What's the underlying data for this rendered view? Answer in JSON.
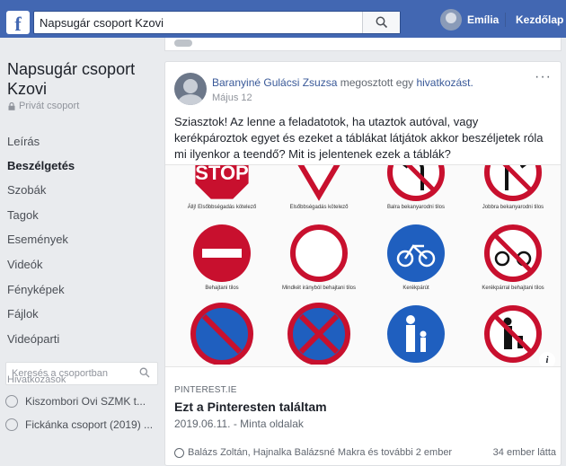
{
  "topbar": {
    "logo": "f",
    "search_value": "Napsugár csoport Kzovi",
    "user_name": "Emília",
    "home_label": "Kezdőlap"
  },
  "sidebar": {
    "group_title": "Napsugár csoport Kzovi",
    "privacy": "Privát csoport",
    "nav": [
      {
        "label": "Leírás"
      },
      {
        "label": "Beszélgetés"
      },
      {
        "label": "Szobák"
      },
      {
        "label": "Tagok"
      },
      {
        "label": "Események"
      },
      {
        "label": "Videók"
      },
      {
        "label": "Fényképek"
      },
      {
        "label": "Fájlok"
      },
      {
        "label": "Videóparti"
      }
    ],
    "search_placeholder": "Keresés a csoportban",
    "shortcuts_label": "Hivatkozások",
    "shortcuts": [
      {
        "label": "Kiszombori Ovi SZMK t..."
      },
      {
        "label": "Fickánka csoport (2019) ..."
      }
    ]
  },
  "post": {
    "author": "Baranyiné Gulácsi Zsuzsa",
    "action": "megosztott egy",
    "link_word": "hivatkozást.",
    "date": "Május 12",
    "more": "···",
    "text": "Sziasztok! Az lenne a feladatotok, ha utaztok autóval, vagy kerékpároztok egyet és ezeket a táblákat látjátok akkor beszéljetek róla mi ilyenkor a teendő? Mit is jelentenek ezek a táblák?",
    "preview": {
      "signs": [
        {
          "caption": "Állj! Elsőbbségadás kötelező",
          "type": "stop"
        },
        {
          "caption": "Elsőbbségadás kötelező",
          "type": "yield"
        },
        {
          "caption": "Balra bekanyarodni tilos",
          "type": "noleft"
        },
        {
          "caption": "Jobbra bekanyarodni tilos",
          "type": "noright"
        },
        {
          "caption": "Behajtani tilos",
          "type": "noentry"
        },
        {
          "caption": "Mindkét irányból behajtani tilos",
          "type": "closed"
        },
        {
          "caption": "Kerékpárút",
          "type": "bike"
        },
        {
          "caption": "Kerékpárral behajtani tilos",
          "type": "nobike"
        },
        {
          "caption": "",
          "type": "noparking"
        },
        {
          "caption": "",
          "type": "nostopping"
        },
        {
          "caption": "",
          "type": "pedestrian"
        },
        {
          "caption": "",
          "type": "nopedestrian"
        }
      ],
      "info": "i"
    },
    "link_domain": "PINTEREST.IE",
    "link_title": "Ezt a Pinteresten találtam",
    "link_sub": "2019.06.11. - Minta oldalak",
    "reactors": "Balázs Zoltán, Hajnalka Balázsné Makra és további 2 ember",
    "seen": "34 ember látta"
  },
  "colors": {
    "brand": "#4267b2",
    "link": "#385898",
    "sign_red": "#c8102e",
    "sign_blue": "#1f5fbf"
  }
}
